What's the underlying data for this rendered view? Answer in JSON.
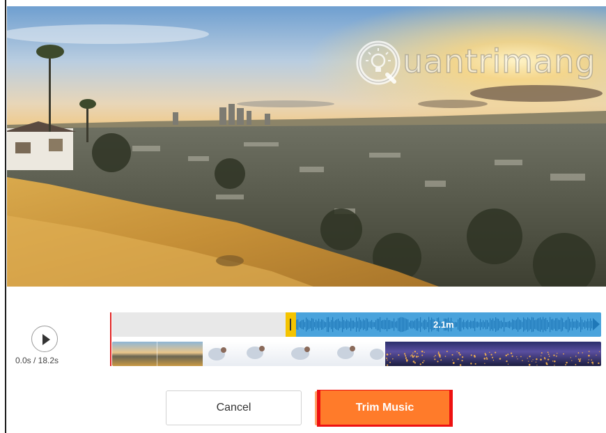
{
  "watermark": {
    "text": "uantrimang"
  },
  "player": {
    "time_text": "0.0s / 18.2s"
  },
  "audio": {
    "duration_label": "2.1m",
    "waveform_color": "#2e8fd0",
    "handle_color": "#f5c400"
  },
  "actions": {
    "cancel_label": "Cancel",
    "trim_label": "Trim Music"
  },
  "colors": {
    "accent": "#ff7b2a",
    "playhead": "#e02020"
  }
}
